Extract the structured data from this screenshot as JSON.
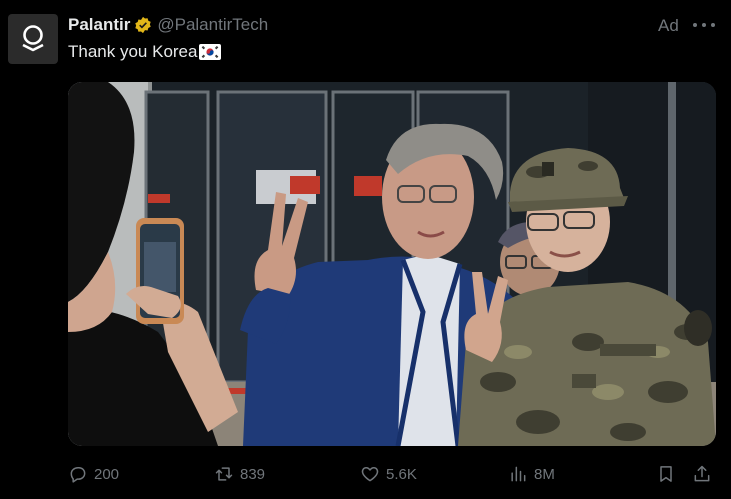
{
  "post": {
    "author_name": "Palantir",
    "author_handle": "@PalantirTech",
    "ad_label": "Ad",
    "text": "Thank you Korea",
    "flag_icon": "south-korea-flag-icon",
    "verified_icon": "verified-badge-icon",
    "colors": {
      "background": "#000000",
      "primary_text": "#e7e9ea",
      "secondary_text": "#71767b",
      "verified_gold": "#e2b719"
    }
  },
  "actions": {
    "replies": "200",
    "reposts": "839",
    "likes": "5.6K",
    "views": "8M"
  }
}
